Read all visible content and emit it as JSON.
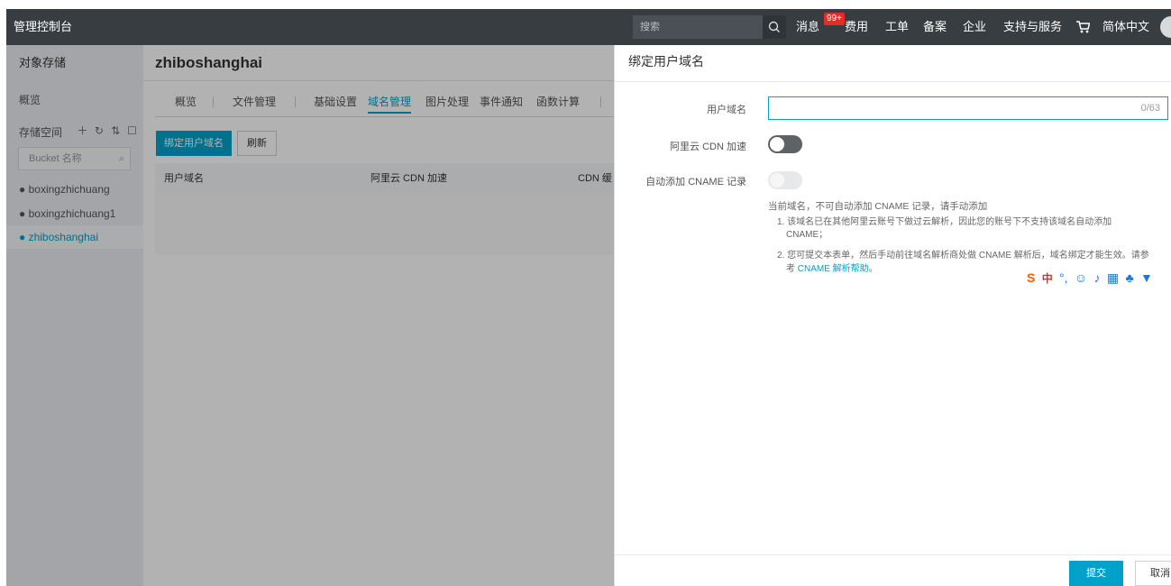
{
  "topbar": {
    "brand": "管理控制台",
    "search_placeholder": "搜索",
    "search_icon": "search-icon",
    "nav": [
      "消息",
      "费用",
      "工单",
      "备案",
      "企业",
      "支持与服务",
      "简体中文"
    ],
    "badge": "99+",
    "cart_icon": "cart-icon"
  },
  "sidebar": {
    "title": "对象存储",
    "overview": "概览",
    "space_label": "存储空间",
    "tool_icons": [
      "plus-icon",
      "refresh-icon",
      "sort-icon",
      "edit-icon"
    ],
    "search_placeholder": "Bucket 名称",
    "buckets": [
      "boxingzhichuang",
      "boxingzhichuang1",
      "zhiboshanghai"
    ],
    "active_bucket": "zhiboshanghai"
  },
  "main": {
    "bucket_title": "zhiboshanghai",
    "tabs": [
      "概览",
      "文件管理",
      "基础设置",
      "域名管理",
      "图片处理",
      "事件通知",
      "函数计算"
    ],
    "active_tab": "域名管理",
    "bind_button": "绑定用户域名",
    "refresh_button": "刷新",
    "columns": [
      "用户域名",
      "阿里云 CDN 加速",
      "CDN 缓"
    ]
  },
  "drawer": {
    "title": "绑定用户域名",
    "domain_label": "用户域名",
    "domain_value": "",
    "domain_count": "0/63",
    "cdn_label": "阿里云 CDN 加速",
    "cname_label": "自动添加 CNAME 记录",
    "hint": "当前域名，不可自动添加 CNAME 记录，请手动添加",
    "note1_line1": "1. 该域名已在其他阿里云账号下做过云解析，因此您的账号下不支持该域名自动添加",
    "note1_line2": "CNAME；",
    "note2_line1": "2. 您可提交本表单，然后手动前往域名解析商处做 CNAME 解析后，域名绑定才能生效。请参",
    "note2_prefix": "考 ",
    "note2_link": "CNAME 解析帮助",
    "note2_suffix": "。",
    "submit": "提交",
    "cancel": "取消"
  },
  "colors": {
    "accent": "#00a2ca",
    "topbar": "#373d41",
    "badge": "#e02e24"
  }
}
